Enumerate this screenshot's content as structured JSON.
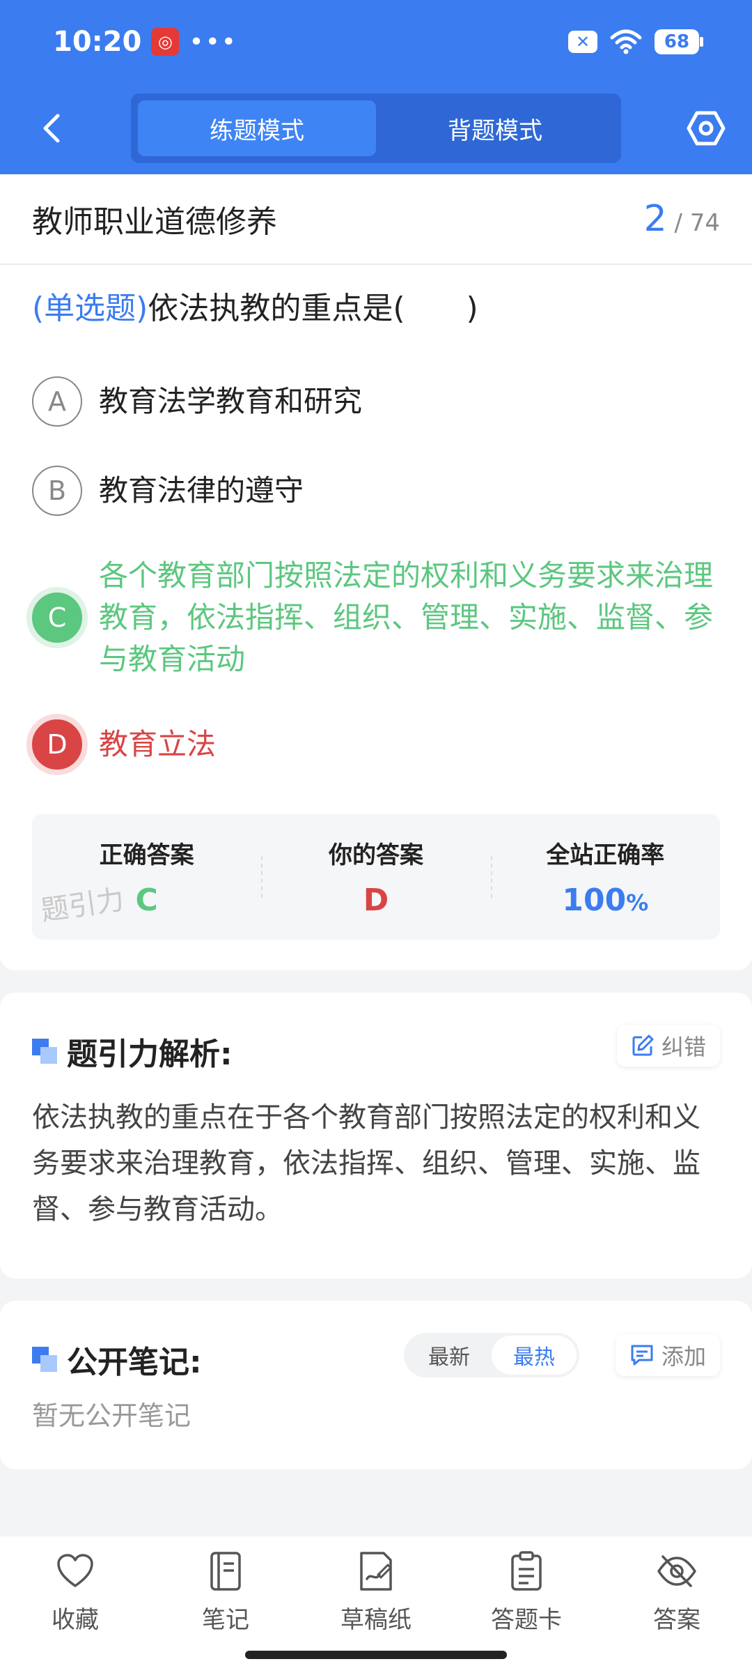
{
  "status_bar": {
    "time": "10:20",
    "app_badge": "◎",
    "dots": "•••",
    "close_badge": "✕",
    "battery": "68"
  },
  "header": {
    "modes": [
      {
        "label": "练题模式",
        "active": true
      },
      {
        "label": "背题模式",
        "active": false
      }
    ]
  },
  "question_card": {
    "topic": "教师职业道德修养",
    "current": "2",
    "total": "/ 74",
    "question_type": "(单选题)",
    "question_text": "依法执教的重点是(　　)",
    "options": [
      {
        "letter": "A",
        "text": "教育法学教育和研究",
        "state": "normal"
      },
      {
        "letter": "B",
        "text": "教育法律的遵守",
        "state": "normal"
      },
      {
        "letter": "C",
        "text": "各个教育部门按照法定的权利和义务要求来治理教育，依法指挥、组织、管理、实施、监督、参与教育活动",
        "state": "correct"
      },
      {
        "letter": "D",
        "text": "教育立法",
        "state": "wrong"
      }
    ],
    "result": {
      "correct_label": "正确答案",
      "correct_value": "C",
      "yours_label": "你的答案",
      "yours_value": "D",
      "rate_label": "全站正确率",
      "rate_value": "100",
      "rate_unit": "%",
      "watermark": "题引力"
    }
  },
  "analysis": {
    "title": "题引力解析:",
    "report_label": "纠错",
    "text": "依法执教的重点在于各个教育部门按照法定的权利和义务要求来治理教育，依法指挥、组织、管理、实施、监督、参与教育活动。"
  },
  "notes": {
    "title": "公开笔记:",
    "sort_options": [
      {
        "label": "最新",
        "active": false
      },
      {
        "label": "最热",
        "active": true
      }
    ],
    "add_label": "添加",
    "empty_text": "暂无公开笔记"
  },
  "bottom_tabs": [
    {
      "label": "收藏",
      "icon": "heart-icon"
    },
    {
      "label": "笔记",
      "icon": "notebook-icon"
    },
    {
      "label": "草稿纸",
      "icon": "draft-paper-icon"
    },
    {
      "label": "答题卡",
      "icon": "answer-sheet-icon"
    },
    {
      "label": "答案",
      "icon": "eye-off-icon"
    }
  ],
  "colors": {
    "brand": "#3b7cf0",
    "correct": "#5cc77f",
    "wrong": "#d94545"
  }
}
